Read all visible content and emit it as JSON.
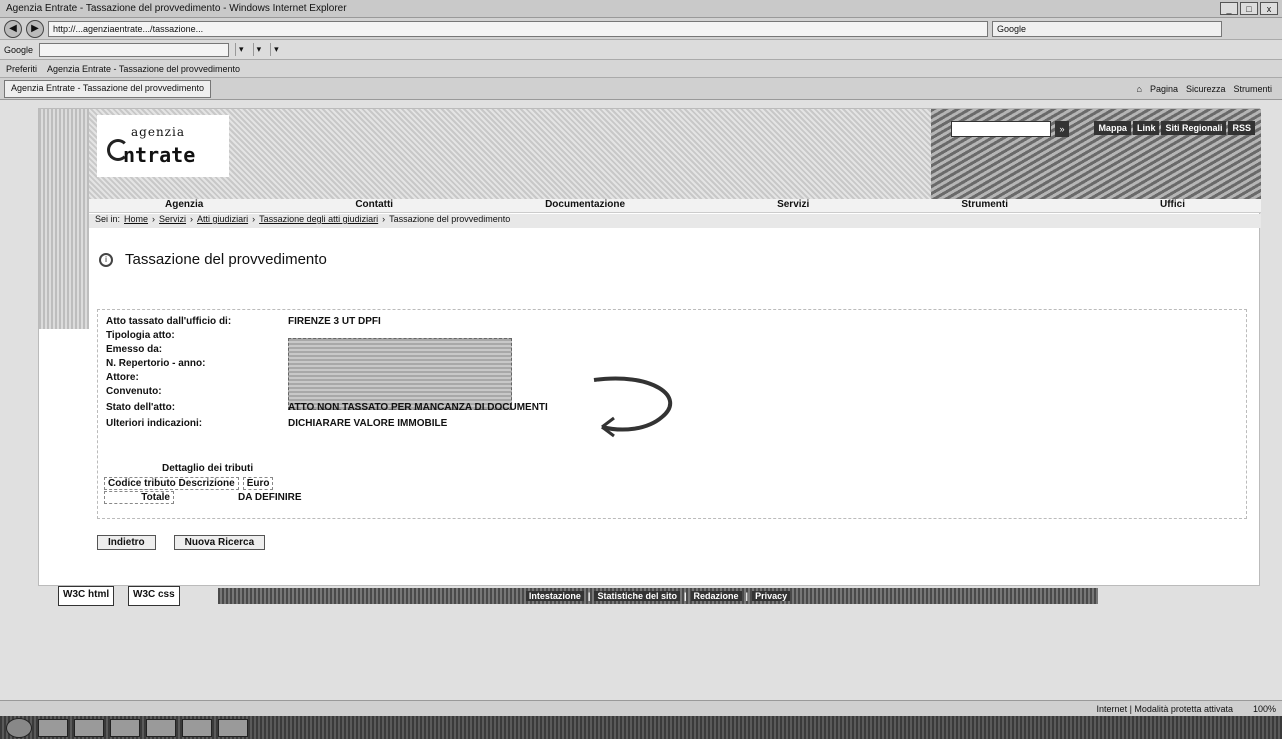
{
  "window": {
    "title": "Agenzia Entrate - Tassazione del provvedimento - Windows Internet Explorer",
    "controls": [
      "_",
      "□",
      "x"
    ]
  },
  "browser": {
    "url": "http://...agenziaentrate.../tassazione...",
    "search_placeholder": "Google",
    "google_label": "Google",
    "toolbar_items": [
      "Preferiti",
      "Agenzia Entrate - Tassazione del provvedimento"
    ],
    "tab_title": "Agenzia Entrate - Tassazione del provvedimento",
    "cmd_items": [
      "Pagina",
      "Sicurezza",
      "Strumenti"
    ]
  },
  "site": {
    "logo_top": "agenzia",
    "logo_main": "ntrate",
    "toplinks": [
      "Mappa",
      "Link",
      "Siti Regionali",
      "RSS"
    ],
    "nav": [
      "Agenzia",
      "Contatti",
      "Documentazione",
      "Servizi",
      "Strumenti",
      "Uffici"
    ],
    "breadcrumb": {
      "prefix": "Sei in:",
      "items": [
        "Home",
        "Servizi",
        "Atti giudiziari",
        "Tassazione degli atti giudiziari",
        "Tassazione del provvedimento"
      ]
    },
    "page_title": "Tassazione del provvedimento"
  },
  "record": {
    "fields": [
      {
        "label": "Atto tassato dall'ufficio di:",
        "value": "FIRENZE 3 UT DPFI"
      },
      {
        "label": "Tipologia atto:",
        "value": ""
      },
      {
        "label": "Emesso da:",
        "value": ""
      },
      {
        "label": "N. Repertorio - anno:",
        "value": ""
      },
      {
        "label": "Attore:",
        "value": ""
      },
      {
        "label": "Convenuto:",
        "value": ""
      },
      {
        "label": "Stato dell'atto:",
        "value": "ATTO NON TASSATO PER MANCANZA DI DOCUMENTI"
      },
      {
        "label": "Ulteriori indicazioni:",
        "value": "DICHIARARE VALORE IMMOBILE"
      }
    ],
    "tributi_title": "Dettaglio dei tributi",
    "tributi_headers": [
      "Codice tributo Descrizione",
      "Euro"
    ],
    "totale_label": "Totale",
    "totale_value": "DA DEFINIRE"
  },
  "actions": {
    "back": "Indietro",
    "new_search": "Nuova Ricerca"
  },
  "footer": {
    "w3c_html": "W3C html",
    "w3c_css": "W3C css",
    "links": [
      "Intestazione",
      "Statistiche del sito",
      "Redazione",
      "Privacy"
    ]
  },
  "status": {
    "zone": "Internet | Modalità protetta attivata",
    "zoom": "100%"
  }
}
